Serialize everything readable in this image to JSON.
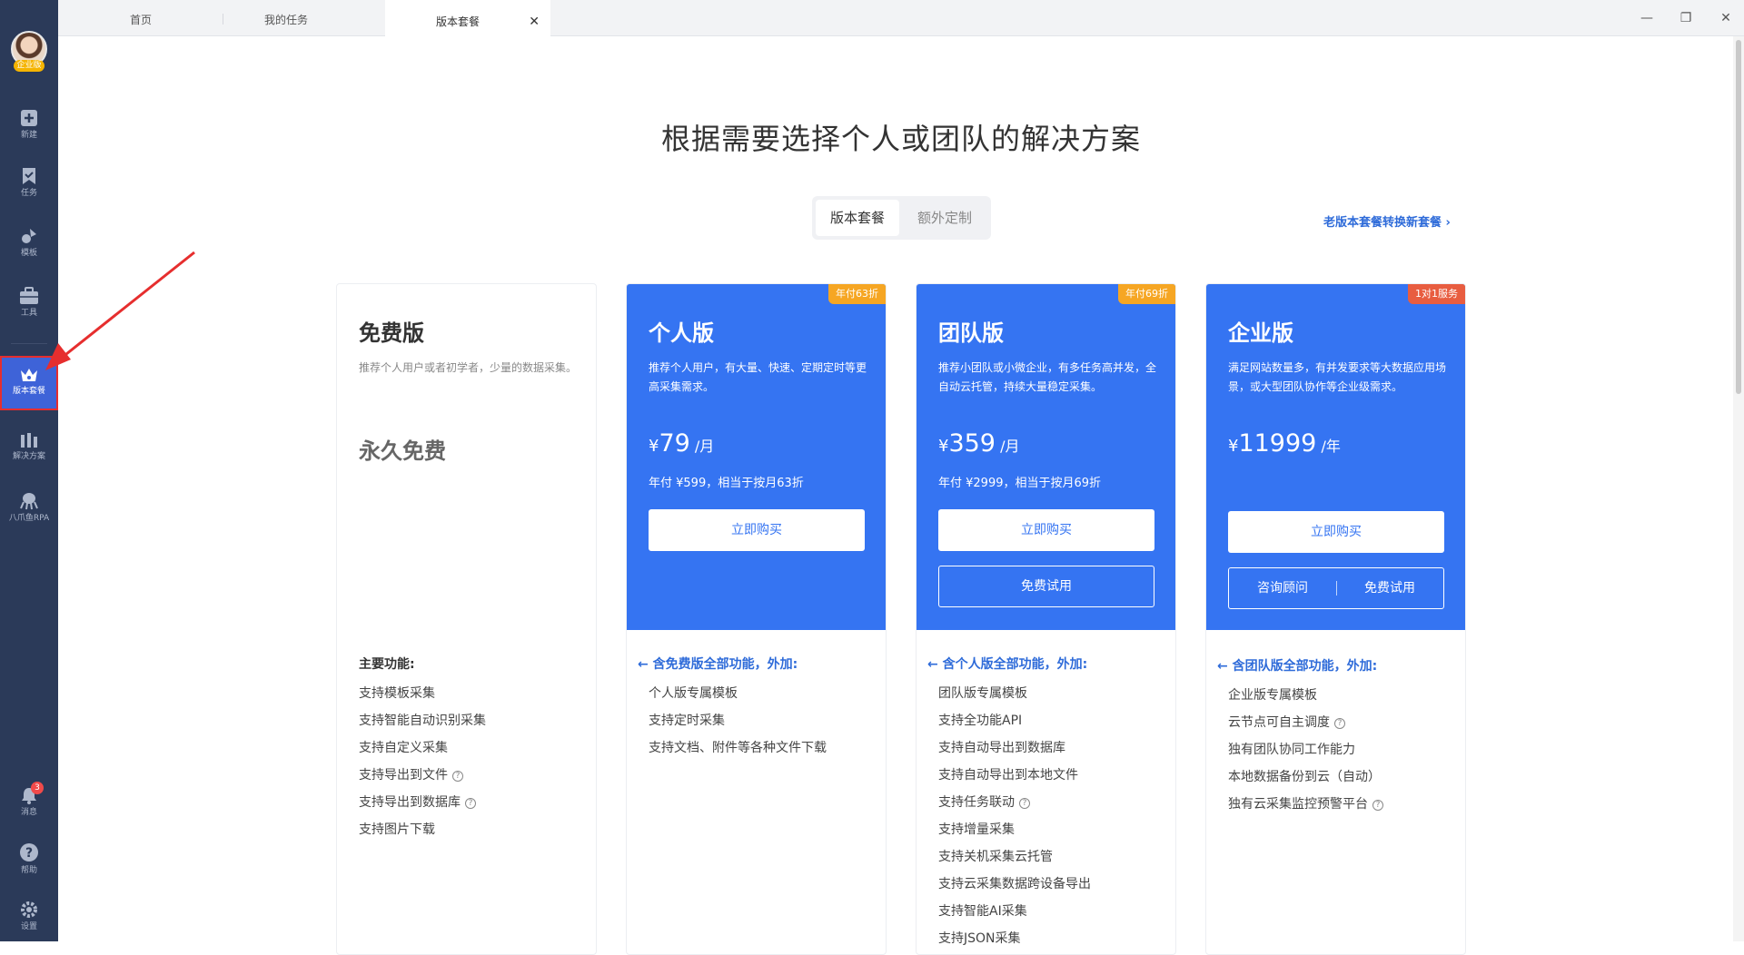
{
  "sidebar": {
    "badge": "企业版",
    "items": [
      {
        "label": "新建",
        "icon": "plus-square-icon"
      },
      {
        "label": "任务",
        "icon": "bookmark-icon"
      },
      {
        "label": "模板",
        "icon": "template-icon"
      },
      {
        "label": "工具",
        "icon": "toolbox-icon"
      },
      {
        "label": "版本套餐",
        "icon": "crown-icon"
      },
      {
        "label": "解决方案",
        "icon": "solution-icon"
      },
      {
        "label": "八爪鱼RPA",
        "icon": "octopus-icon"
      }
    ],
    "bottom": [
      {
        "label": "消息",
        "icon": "bell-icon",
        "count": "3"
      },
      {
        "label": "帮助",
        "icon": "help-icon"
      },
      {
        "label": "设置",
        "icon": "gear-icon"
      }
    ]
  },
  "tabs": [
    {
      "label": "首页"
    },
    {
      "label": "我的任务"
    },
    {
      "label": "版本套餐",
      "close": "✕"
    }
  ],
  "window_controls": {
    "minimize": "—",
    "restore": "❐",
    "close": "✕"
  },
  "page": {
    "title": "根据需要选择个人或团队的解决方案",
    "segments": [
      "版本套餐",
      "额外定制"
    ],
    "old_link": "老版本套餐转换新套餐 ›"
  },
  "plans": [
    {
      "name": "免费版",
      "desc": "推荐个人用户或者初学者，少量的数据采集。",
      "price_text": "永久免费",
      "features_title": "主要功能:",
      "features": [
        "支持模板采集",
        "支持智能自动识别采集",
        "支持自定义采集",
        "支持导出到文件",
        "支持导出到数据库",
        "支持图片下载"
      ],
      "help_marks": [
        false,
        false,
        false,
        true,
        true,
        false
      ]
    },
    {
      "name": "个人版",
      "ribbon": "年付63折",
      "desc": "推荐个人用户，有大量、快速、定期定时等更高采集需求。",
      "currency": "¥",
      "price": "79",
      "unit": "/月",
      "yearly": "年付 ¥599，相当于按月63折",
      "buy": "立即购买",
      "features_title": "← 含免费版全部功能，外加:",
      "features": [
        "个人版专属模板",
        "支持定时采集",
        "支持文档、附件等各种文件下载"
      ]
    },
    {
      "name": "团队版",
      "ribbon": "年付69折",
      "desc": "推荐小团队或小微企业，有多任务高并发，全自动云托管，持续大量稳定采集。",
      "currency": "¥",
      "price": "359",
      "unit": "/月",
      "yearly": "年付 ¥2999，相当于按月69折",
      "buy": "立即购买",
      "trial": "免费试用",
      "features_title": "← 含个人版全部功能，外加:",
      "features": [
        "团队版专属模板",
        "支持全功能API",
        "支持自动导出到数据库",
        "支持自动导出到本地文件",
        "支持任务联动",
        "支持增量采集",
        "支持关机采集云托管",
        "支持云采集数据跨设备导出",
        "支持智能AI采集",
        "支持JSON采集"
      ],
      "help_marks": [
        false,
        false,
        false,
        false,
        true,
        false,
        false,
        false,
        false,
        false
      ]
    },
    {
      "name": "企业版",
      "ribbon": "1对1服务",
      "desc": "满足网站数量多，有并发要求等大数据应用场景，或大型团队协作等企业级需求。",
      "currency": "¥",
      "price": "11999",
      "unit": "/年",
      "buy": "立即购买",
      "consult": "咨询顾问",
      "trial": "免费试用",
      "features_title": "← 含团队版全部功能，外加:",
      "features": [
        "企业版专属模板",
        "云节点可自主调度",
        "独有团队协同工作能力",
        "本地数据备份到云（自动）",
        "独有云采集监控预警平台"
      ],
      "help_marks": [
        false,
        true,
        false,
        false,
        true
      ]
    }
  ],
  "colors": {
    "sidebar": "#2b3a59",
    "accent": "#3574f2",
    "ribbon": "#f6a623",
    "ribbon_enterprise": "#e85d40",
    "highlight": "#e62e2e"
  }
}
